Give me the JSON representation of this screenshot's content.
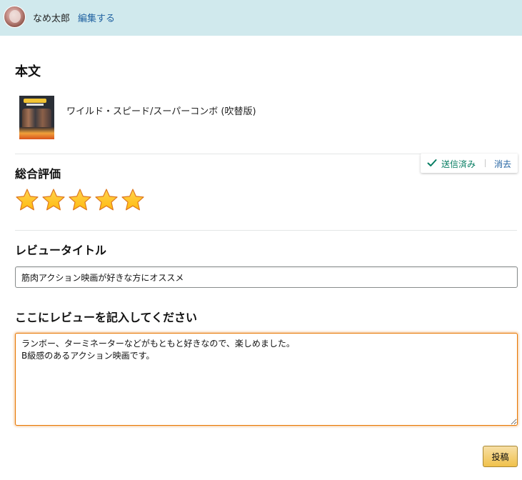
{
  "header": {
    "user_name": "なめ太郎",
    "edit_label": "編集する",
    "background": "#d0e9ed"
  },
  "section": {
    "title": "本文"
  },
  "product": {
    "name": "ワイルド・スピード/スーパーコンボ (吹替版)"
  },
  "rating": {
    "heading": "総合評価",
    "value": 5,
    "max": 5,
    "star_color": "#ffbb10",
    "status": {
      "sent_label": "送信済み",
      "clear_label": "消去",
      "sent_color": "#067d62"
    }
  },
  "review_title": {
    "heading": "レビュータイトル",
    "value": "筋肉アクション映画が好きな方にオススメ"
  },
  "review_body": {
    "heading": "ここにレビューを記入してください",
    "value": "ランボー、ターミネーターなどがもともと好きなので、楽しめました。\nB級感のあるアクション映画です。",
    "focus_color": "#e77600"
  },
  "submit": {
    "label": "投稿",
    "color": "#f0c14b"
  }
}
